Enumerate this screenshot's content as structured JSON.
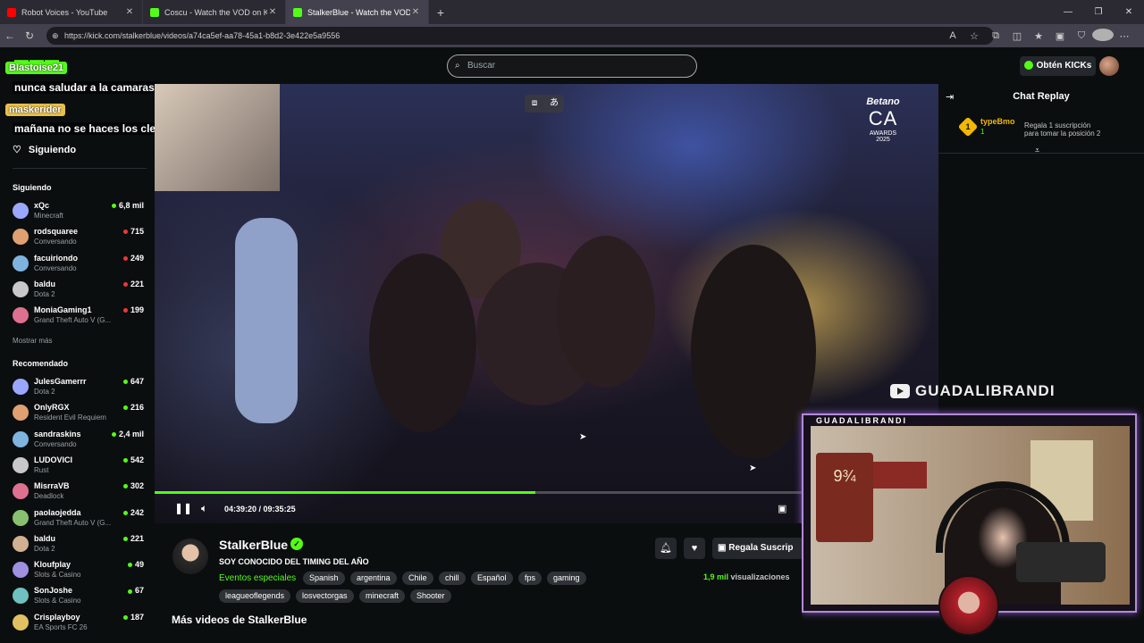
{
  "browser": {
    "tabs": [
      {
        "title": "Robot Voices - YouTube",
        "favicon": "youtube-icon"
      },
      {
        "title": "Coscu - Watch the VOD on Kick",
        "favicon": "kick-icon"
      },
      {
        "title": "StalkerBlue - Watch the VOD on Kick",
        "favicon": "kick-icon"
      }
    ],
    "url": "https://kick.com/stalkerblue/videos/a74ca5ef-aa78-45a1-b8d2-3e422e5a9556"
  },
  "header": {
    "search_placeholder": "Buscar",
    "get_kicks": "Obtén KICKs",
    "brand_color": "#53fc18"
  },
  "stream_overlay": {
    "user1": "Blastoise21",
    "msg1": "nunca saludar a la camaras",
    "user2": "maskerider",
    "msg2": "mañana no se haces los cleopatras?"
  },
  "sidebar": {
    "follow_button": "Siguiendo",
    "following_title": "Siguiendo",
    "following": [
      {
        "name": "xQc",
        "category": "Minecraft",
        "viewers": "6,8 mil",
        "live": true
      },
      {
        "name": "rodsquaree",
        "category": "Conversando",
        "viewers": "715",
        "live": false
      },
      {
        "name": "facuiriondo",
        "category": "Conversando",
        "viewers": "249",
        "live": false
      },
      {
        "name": "baldu",
        "category": "Dota 2",
        "viewers": "221",
        "live": false
      },
      {
        "name": "MoniaGaming1",
        "category": "Grand Theft Auto V (G...",
        "viewers": "199",
        "live": false
      }
    ],
    "show_more": "Mostrar más",
    "recommended_title": "Recomendado",
    "recommended": [
      {
        "name": "JulesGamerrr",
        "category": "Dota 2",
        "viewers": "647",
        "live": true
      },
      {
        "name": "OnlyRGX",
        "category": "Resident Evil Requiem",
        "viewers": "216",
        "live": true
      },
      {
        "name": "sandraskins",
        "category": "Conversando",
        "viewers": "2,4 mil",
        "live": true
      },
      {
        "name": "LUDOVICI",
        "category": "Rust",
        "viewers": "542",
        "live": true
      },
      {
        "name": "MisrraVB",
        "category": "Deadlock",
        "viewers": "302",
        "live": true
      },
      {
        "name": "paolaojedda",
        "category": "Grand Theft Auto V (G...",
        "viewers": "242",
        "live": true
      },
      {
        "name": "baldu",
        "category": "Dota 2",
        "viewers": "221",
        "live": true
      },
      {
        "name": "Kloufplay",
        "category": "Slots & Casino",
        "viewers": "49",
        "live": true
      },
      {
        "name": "SonJoshe",
        "category": "Slots & Casino",
        "viewers": "67",
        "live": true
      },
      {
        "name": "Crisplayboy",
        "category": "EA Sports FC 26",
        "viewers": "187",
        "live": true
      }
    ]
  },
  "video": {
    "badge_brand": "Betano",
    "badge_big": "CA",
    "badge_small": "AWARDS",
    "badge_year": "2025",
    "current_time": "04:39:20",
    "duration": "09:35:25",
    "progress_fraction": 0.486,
    "webcam_channel": "GUADALIBRANDI",
    "webcam_label": "GUADALIBRANDI"
  },
  "chat": {
    "title": "Chat Replay",
    "pinned_rank": "1",
    "pinned_user": "typeBmo",
    "pinned_count": "1",
    "pinned_gift_line1": "Regala 1 suscripción",
    "pinned_gift_line2": "para tomar la posición 2"
  },
  "channel": {
    "name": "StalkerBlue",
    "subtitle": "SOY CONOCIDO DEL TIMING DEL AÑO",
    "category": "Eventos especiales",
    "tags_row1": [
      "Spanish",
      "argentina",
      "Chile",
      "chill",
      "Español",
      "fps",
      "gaming"
    ],
    "tags_row2": [
      "leagueoflegends",
      "losvectorgas",
      "minecraft",
      "Shooter"
    ],
    "gift_button": "Regala Suscrip",
    "views_count": "1,9 mil",
    "views_label": "visualizaciones",
    "more_videos": "Más videos de StalkerBlue"
  }
}
